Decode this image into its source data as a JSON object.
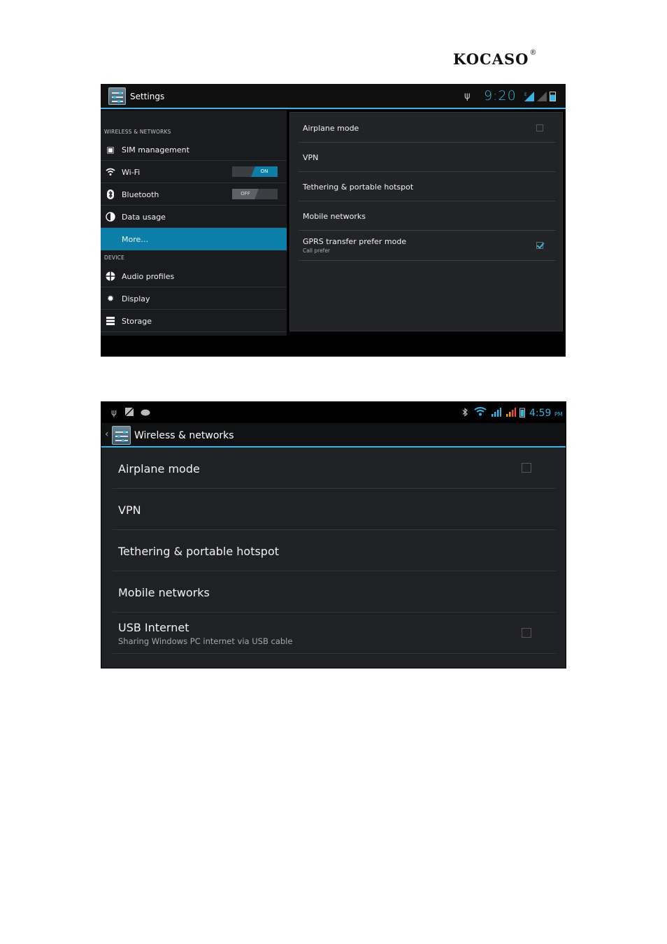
{
  "logo": {
    "text": "KOCASO",
    "mark": "®"
  },
  "shot1": {
    "status": {
      "title": "Settings",
      "time": "9:20",
      "usb_icon": "usb-icon",
      "signal_icon": "signal-icon",
      "battery_icon": "battery-icon"
    },
    "sections": {
      "wireless": "WIRELESS & NETWORKS",
      "device": "DEVICE"
    },
    "left_items": [
      {
        "label": "SIM management",
        "icon": "sim-icon"
      },
      {
        "label": "Wi-Fi",
        "icon": "wifi-icon",
        "toggle": "ON"
      },
      {
        "label": "Bluetooth",
        "icon": "bluetooth-icon",
        "toggle": "OFF"
      },
      {
        "label": "Data usage",
        "icon": "data-usage-icon"
      },
      {
        "label": "More…",
        "icon": "",
        "selected": true
      },
      {
        "label": "Audio profiles",
        "icon": "audio-icon"
      },
      {
        "label": "Display",
        "icon": "display-icon"
      },
      {
        "label": "Storage",
        "icon": "storage-icon"
      }
    ],
    "right_items": [
      {
        "label": "Airplane mode",
        "checkbox": "unchecked"
      },
      {
        "label": "VPN"
      },
      {
        "label": "Tethering & portable hotspot"
      },
      {
        "label": "Mobile networks"
      },
      {
        "label": "GPRS transfer prefer mode",
        "sub": "Call prefer",
        "checkbox": "checked"
      }
    ]
  },
  "shot2": {
    "status": {
      "time": "4:59",
      "ampm": "PM"
    },
    "title": "Wireless & networks",
    "items": [
      {
        "label": "Airplane mode",
        "checkbox": "unchecked"
      },
      {
        "label": "VPN"
      },
      {
        "label": "Tethering & portable hotspot"
      },
      {
        "label": "Mobile networks"
      },
      {
        "label": "USB Internet",
        "sub": "Sharing Windows PC internet via USB cable",
        "checkbox": "unchecked"
      }
    ]
  },
  "colors": {
    "accent": "#33b5e5",
    "selected": "#0b7fa8",
    "panel": "#222326",
    "bg_dark": "#1a1b1e"
  }
}
